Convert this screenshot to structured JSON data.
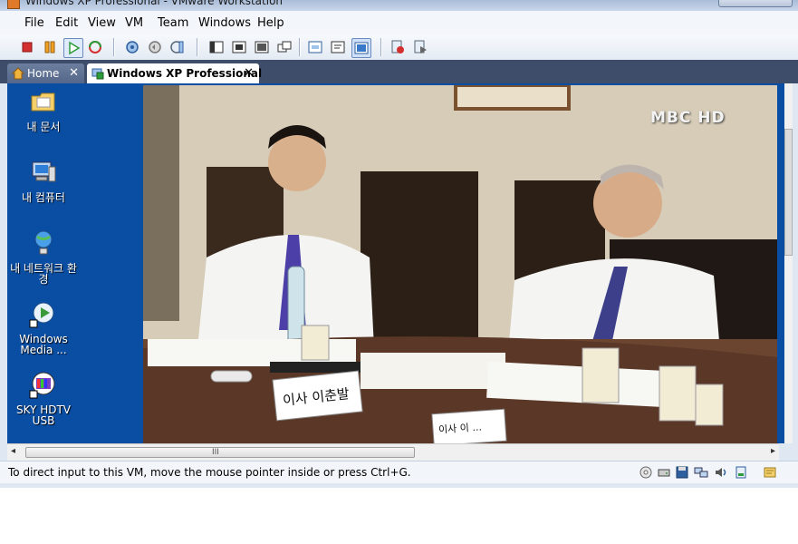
{
  "window": {
    "title": "Windows XP Professional - VMware Workstation"
  },
  "menu": [
    "File",
    "Edit",
    "View",
    "VM",
    "Team",
    "Windows",
    "Help"
  ],
  "tabs": [
    {
      "label": "Home",
      "close": "✕"
    },
    {
      "label": "Windows XP Professional",
      "close": "✕"
    }
  ],
  "desktop_icons": [
    {
      "label": "내 문서"
    },
    {
      "label": "내 컴퓨터"
    },
    {
      "label": "내 네트워크 환경"
    },
    {
      "label": "Windows Media ..."
    },
    {
      "label": "SKY HDTV USB"
    }
  ],
  "video": {
    "watermark": "MBC HD",
    "nameplate": "이사 이춘발",
    "nameplate2": "이사 이 ..."
  },
  "hscroll": {
    "grip": "III",
    "left": "◂",
    "right": "▸"
  },
  "status": {
    "text": "To direct input to this VM, move the mouse pointer inside or press Ctrl+G."
  },
  "colors": {
    "desktop": "#0a4ea3",
    "tabbar": "#3d4d6a",
    "accent_red": "#d32f2f",
    "accent_green": "#2e9b3a"
  }
}
